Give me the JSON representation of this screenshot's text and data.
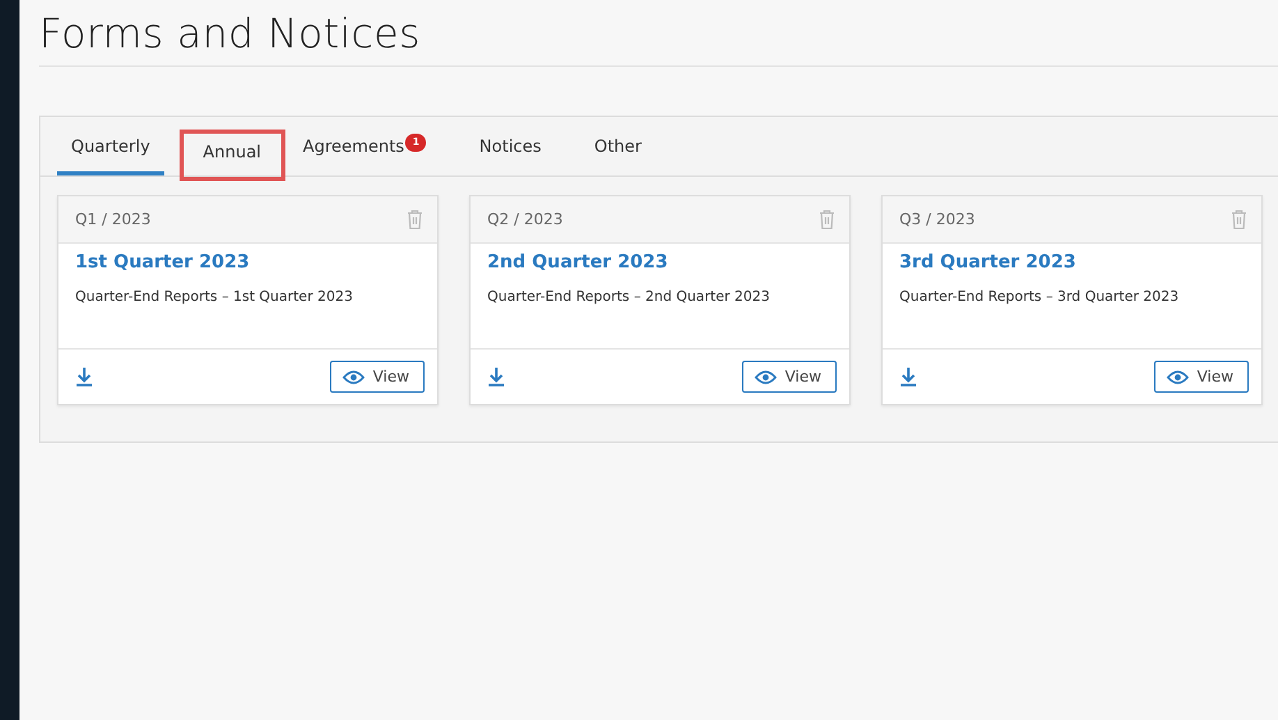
{
  "page": {
    "title": "Forms and Notices"
  },
  "tabs": [
    {
      "label": "Quarterly",
      "selected": true,
      "highlighted": false
    },
    {
      "label": "Annual",
      "selected": false,
      "highlighted": true
    },
    {
      "label": "Agreements",
      "selected": false,
      "highlighted": false,
      "badge": "1"
    },
    {
      "label": "Notices",
      "selected": false,
      "highlighted": false
    },
    {
      "label": "Other",
      "selected": false,
      "highlighted": false
    }
  ],
  "cards": [
    {
      "period": "Q1 / 2023",
      "title": "1st Quarter 2023",
      "description": "Quarter-End Reports – 1st Quarter 2023",
      "button": "View"
    },
    {
      "period": "Q2 / 2023",
      "title": "2nd Quarter 2023",
      "description": "Quarter-End Reports – 2nd Quarter 2023",
      "button": "View"
    },
    {
      "period": "Q3 / 2023",
      "title": "3rd Quarter 2023",
      "description": "Quarter-End Reports – 3rd Quarter 2023",
      "button": "View"
    }
  ]
}
